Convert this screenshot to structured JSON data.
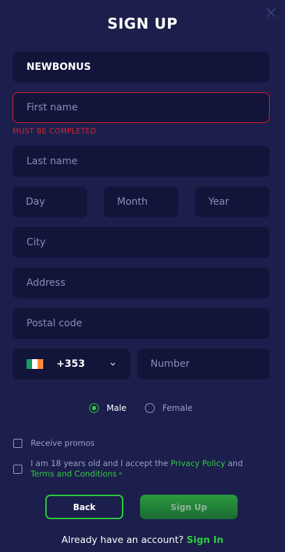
{
  "header": {
    "title": "SIGN UP",
    "close_icon": "close-icon"
  },
  "form": {
    "promo_code_value": "NEWBONUS",
    "first_name_placeholder": "First name",
    "first_name_error": "MUST BE COMPLETED",
    "last_name_placeholder": "Last name",
    "dob": {
      "day_placeholder": "Day",
      "month_placeholder": "Month",
      "year_placeholder": "Year"
    },
    "city_placeholder": "City",
    "address_placeholder": "Address",
    "postal_code_placeholder": "Postal code",
    "phone": {
      "country_code": "+353",
      "number_placeholder": "Number",
      "flag_colors": [
        "#169b62",
        "#ffffff",
        "#ff883e"
      ]
    },
    "gender": {
      "options": [
        "Male",
        "Female"
      ],
      "selected": "Male"
    },
    "checkboxes": {
      "promos_label": "Receive promos",
      "terms_prefix": "I am 18 years old and I accept the ",
      "privacy_link": "Privacy Policy",
      "terms_and": " and",
      "terms_link": "Terms and Conditions",
      "required_mark": " *"
    }
  },
  "buttons": {
    "back_label": "Back",
    "signup_label": "Sign Up"
  },
  "footer": {
    "prompt": "Already have an account? ",
    "signin_link": "Sign In"
  },
  "colors": {
    "background": "#1c1f4b",
    "field": "#12143a",
    "accent": "#2ecc40",
    "error": "#e0202a"
  }
}
